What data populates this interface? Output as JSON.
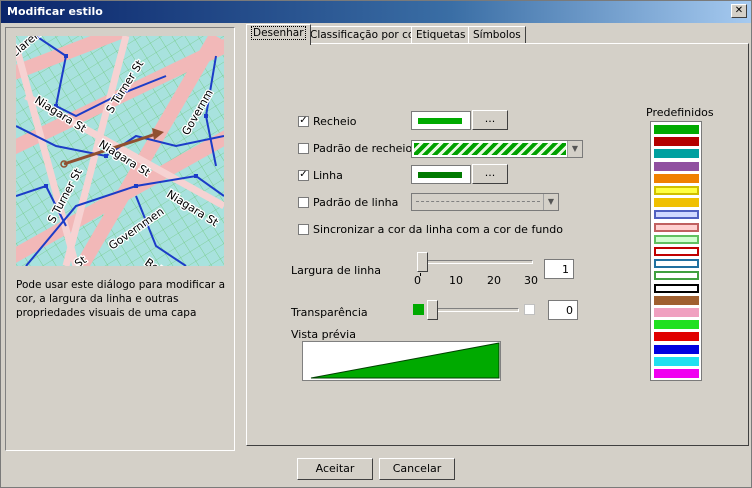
{
  "window": {
    "title": "Modificar estilo",
    "close_glyph": "✕"
  },
  "tabs": [
    {
      "label": "Desenhar",
      "active": true
    },
    {
      "label": "Classificação por cor",
      "active": false
    },
    {
      "label": "Etiquetas",
      "active": false
    },
    {
      "label": "Símbolos",
      "active": false
    }
  ],
  "map_preview": {
    "street_labels": [
      "Claren",
      "S Turner St",
      "Niagara St",
      "Niagara St",
      "S Turner St",
      "Niagara St",
      "Governm",
      "Governmen",
      "St",
      "Bel"
    ]
  },
  "description": "Pode usar este diálogo para modificar a cor, a largura da linha e outras propriedades visuais de uma capa",
  "fill": {
    "label": "Recheio",
    "checked": true,
    "check_glyph": "✓",
    "color": "#00aa00",
    "button_label": "..."
  },
  "fill_pattern": {
    "label": "Padrão de recheio",
    "checked": false,
    "color": "#00a000"
  },
  "line": {
    "label": "Linha",
    "checked": true,
    "check_glyph": "✓",
    "color": "#007a00",
    "button_label": "..."
  },
  "line_pattern": {
    "label": "Padrão de linha",
    "checked": false
  },
  "sync": {
    "label": "Sincronizar a cor da linha com a cor de fundo",
    "checked": false
  },
  "line_width": {
    "label": "Largura de linha",
    "ticks": [
      "0",
      "10",
      "20",
      "30"
    ],
    "value": "1",
    "min": 0,
    "max": 30
  },
  "transparency": {
    "label": "Transparência",
    "value": "0",
    "start_color": "#00aa00"
  },
  "preview": {
    "label": "Vista prévia",
    "fill_color": "#00aa00"
  },
  "presets": {
    "label": "Predefinidos",
    "items": [
      {
        "fill": "#00aa00",
        "border": "#00aa00"
      },
      {
        "fill": "#b40000",
        "border": "#b40000"
      },
      {
        "fill": "#00a0a0",
        "border": "#00a0a0"
      },
      {
        "fill": "#9050a0",
        "border": "#9050a0"
      },
      {
        "fill": "#f08000",
        "border": "#f08000"
      },
      {
        "fill": "#ffff40",
        "border": "#d0c000"
      },
      {
        "fill": "#f0c000",
        "border": "#f0c000"
      },
      {
        "fill": "#d0d8ff",
        "border": "#5060c0"
      },
      {
        "fill": "#ffd0d0",
        "border": "#c06060"
      },
      {
        "fill": "#d0ffd0",
        "border": "#60c060"
      },
      {
        "fill": "#ffffff",
        "border": "#c00000"
      },
      {
        "fill": "#ffffff",
        "border": "#2070a0"
      },
      {
        "fill": "#ffffff",
        "border": "#40a040"
      },
      {
        "fill": "#ffffff",
        "border": "#000000"
      },
      {
        "fill": "#a06030",
        "border": "#a06030"
      },
      {
        "fill": "#f0a0c0",
        "border": "#f0a0c0"
      },
      {
        "fill": "#20e020",
        "border": "#20e020"
      },
      {
        "fill": "#e00000",
        "border": "#e00000"
      },
      {
        "fill": "#0000e0",
        "border": "#0000e0"
      },
      {
        "fill": "#20e0f0",
        "border": "#20e0f0"
      },
      {
        "fill": "#f000f0",
        "border": "#f000f0"
      }
    ]
  },
  "buttons": {
    "ok": "Aceitar",
    "cancel": "Cancelar"
  }
}
